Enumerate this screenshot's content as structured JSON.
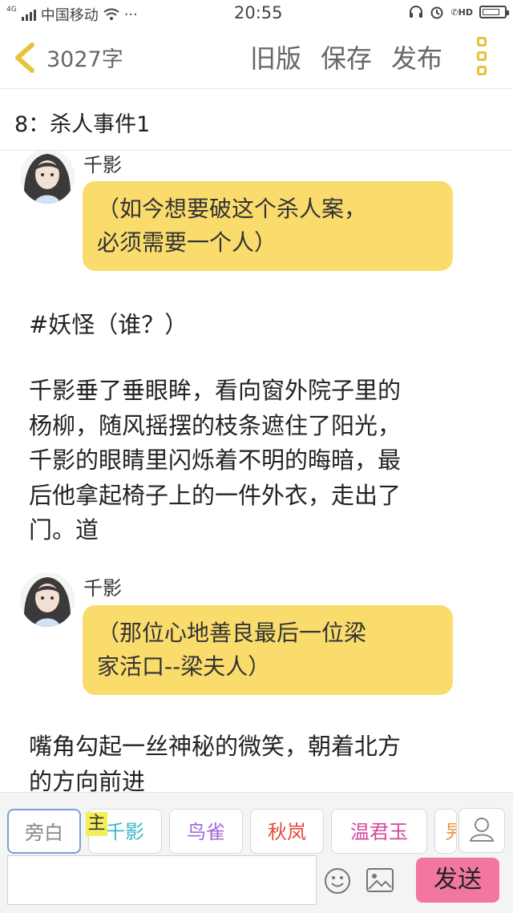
{
  "status": {
    "network": "4G",
    "carrier": "中国移动",
    "more": "···",
    "time": "20:55",
    "hd": "HD"
  },
  "toolbar": {
    "word_count": "3027字",
    "old_version": "旧版",
    "save": "保存",
    "publish": "发布"
  },
  "chapter": {
    "title": "8：杀人事件1"
  },
  "content": {
    "block1": {
      "speaker": "千影",
      "lines": [
        "（如今想要破这个杀人案，",
        "必须需要一个人）"
      ]
    },
    "narr1": [
      "#妖怪（谁？）"
    ],
    "narr2": [
      "千影垂了垂眼眸，看向窗外院子里的",
      "杨柳，随风摇摆的枝条遮住了阳光，",
      "千影的眼睛里闪烁着不明的晦暗，最",
      "后他拿起椅子上的一件外衣，走出了",
      "门。道"
    ],
    "block2": {
      "speaker": "千影",
      "lines": [
        "（那位心地善良最后一位梁",
        "家活口--梁夫人）"
      ]
    },
    "narr3": [
      "嘴角勾起一丝神秘的微笑，朝着北方",
      "的方向前进"
    ]
  },
  "characters": {
    "items": [
      {
        "label": "旁白",
        "color": "#888888"
      },
      {
        "label": "千影",
        "color": "#3cb8c8"
      },
      {
        "label": "鸟雀",
        "color": "#a36ad6"
      },
      {
        "label": "秋岚",
        "color": "#e04b3a"
      },
      {
        "label": "温君玉",
        "color": "#d04c9c"
      },
      {
        "label": "旯",
        "color": "#e89a3c"
      }
    ],
    "main_badge": "主",
    "send_label": "发送",
    "input_value": ""
  }
}
